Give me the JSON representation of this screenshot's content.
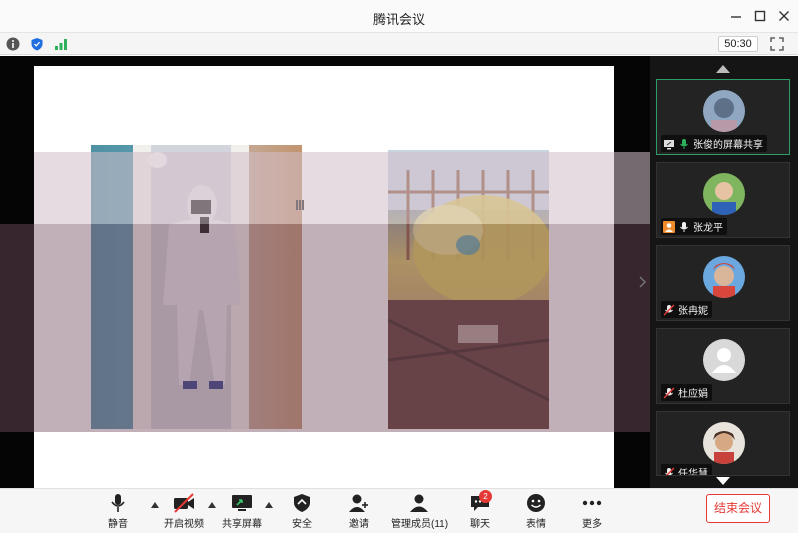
{
  "window": {
    "title": "腾讯会议",
    "minimize_icon": "minimize-icon",
    "maximize_icon": "maximize-icon",
    "close_icon": "close-icon"
  },
  "statusbar": {
    "icons": [
      "info-icon",
      "shield-icon",
      "signal-icon"
    ],
    "timer": "50:30",
    "fullscreen_icon": "fullscreen-icon"
  },
  "participants": [
    {
      "name": "张俊的屏幕共享",
      "status_icons": [
        "screen-share-icon",
        "mic-on-icon"
      ],
      "active": true
    },
    {
      "name": "张龙平",
      "status_icons": [
        "avatar-badge-icon",
        "mic-icon"
      ],
      "active": false
    },
    {
      "name": "张冉妮",
      "status_icons": [
        "mic-muted-icon"
      ],
      "active": false
    },
    {
      "name": "杜应娟",
      "status_icons": [
        "mic-muted-icon"
      ],
      "active": false
    },
    {
      "name": "任华慧",
      "status_icons": [
        "mic-muted-icon"
      ],
      "active": false
    }
  ],
  "toolbar": {
    "mute": "静音",
    "video": "开启视频",
    "share": "共享屏幕",
    "security": "安全",
    "invite": "邀请",
    "members": "管理成员(11)",
    "chat": "聊天",
    "chat_badge": "2",
    "reactions": "表情",
    "more": "更多",
    "end": "结束会议"
  },
  "colors": {
    "active_border": "#2f9e66",
    "end_button": "#e53935",
    "sidebar_bg": "#151515"
  }
}
